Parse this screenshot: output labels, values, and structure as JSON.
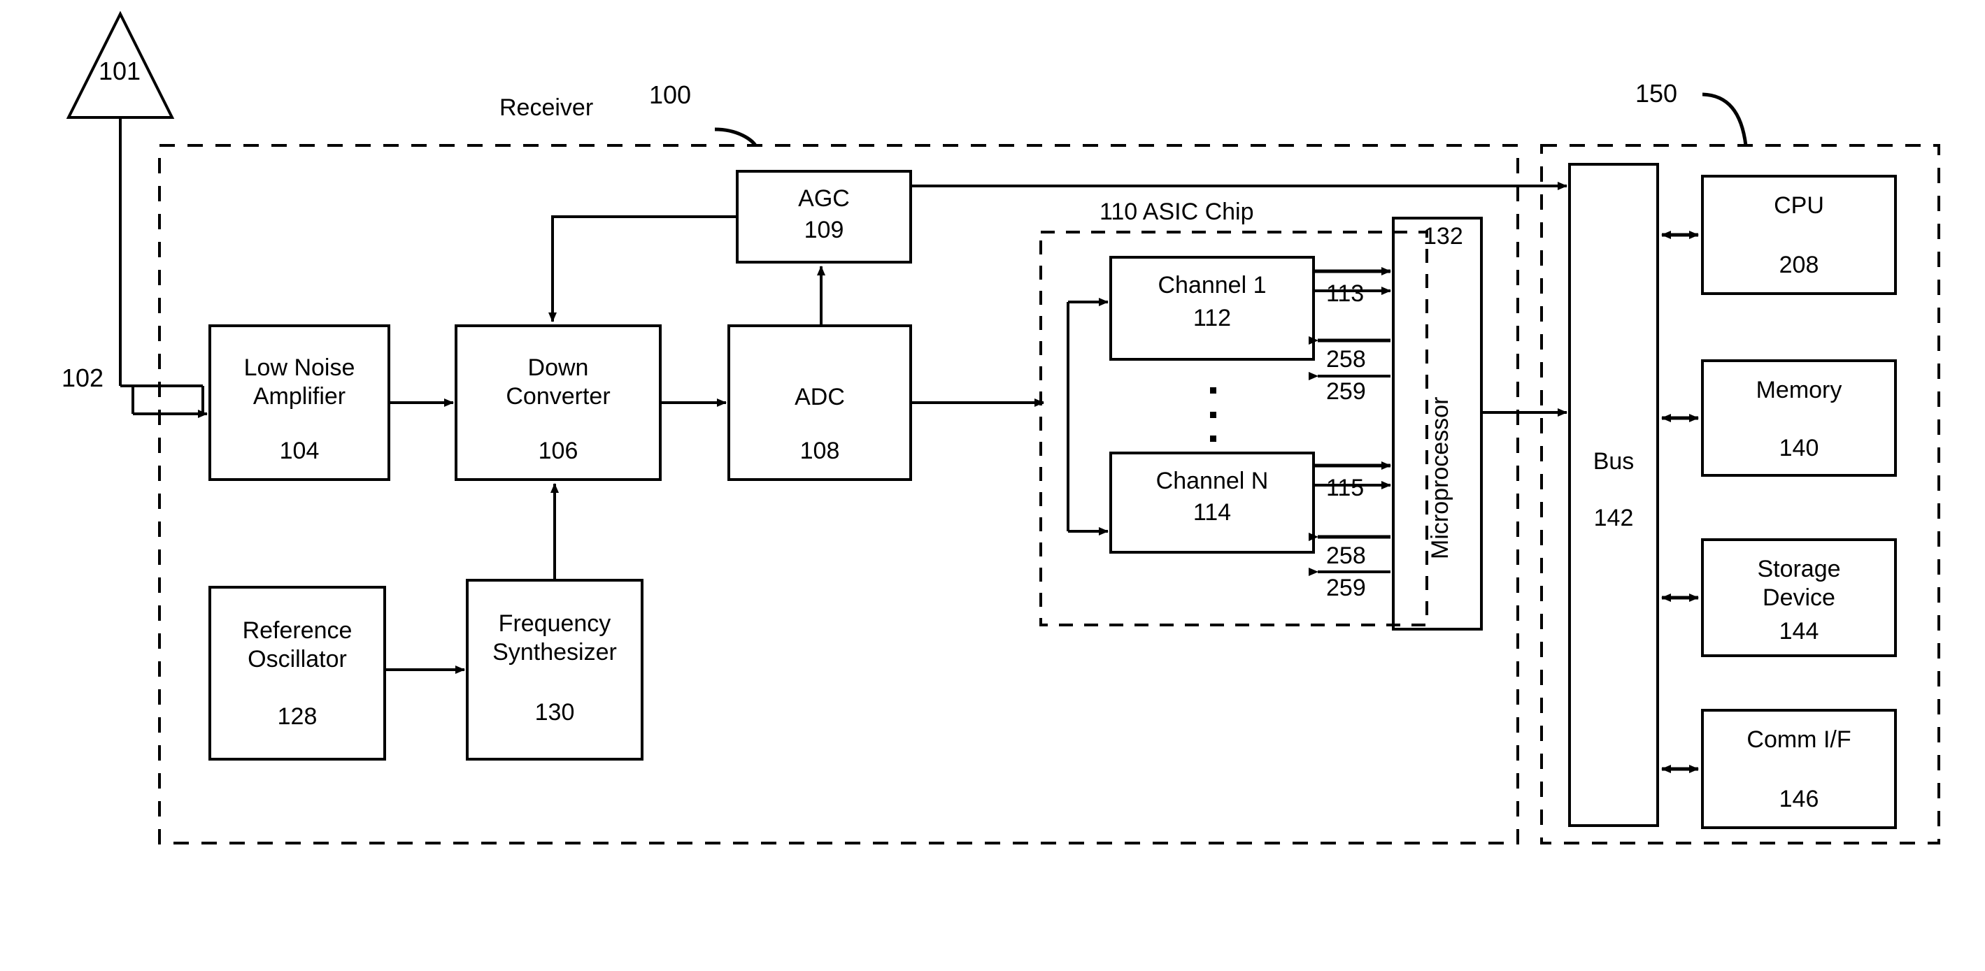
{
  "figure": {
    "type": "patent-block-diagram",
    "antenna": {
      "ref": "101",
      "feed_ref": "102"
    },
    "receiver_group": {
      "title": "Receiver",
      "ref": "100"
    },
    "asic_group": {
      "title": "110 ASIC Chip"
    },
    "computer_group": {
      "ref": "150"
    },
    "blocks": [
      {
        "id": "lna",
        "name": "Low Noise\nAmplifier",
        "ref": "104"
      },
      {
        "id": "dc",
        "name": "Down\nConverter",
        "ref": "106"
      },
      {
        "id": "adc",
        "name": "ADC",
        "ref": "108"
      },
      {
        "id": "agc",
        "name": "AGC",
        "ref": "109"
      },
      {
        "id": "refosc",
        "name": "Reference\nOscillator",
        "ref": "128"
      },
      {
        "id": "fsynth",
        "name": "Frequency\nSynthesizer",
        "ref": "130"
      },
      {
        "id": "ch1",
        "name": "Channel 1",
        "ref": "112"
      },
      {
        "id": "chn",
        "name": "Channel N",
        "ref": "114"
      },
      {
        "id": "micro",
        "name": "Microprocessor",
        "ref": "132"
      },
      {
        "id": "bus",
        "name": "Bus",
        "ref": "142"
      },
      {
        "id": "cpu",
        "name": "CPU",
        "ref": "208"
      },
      {
        "id": "mem",
        "name": "Memory",
        "ref": "140"
      },
      {
        "id": "stor",
        "name": "Storage\nDevice",
        "ref": "144"
      },
      {
        "id": "comm",
        "name": "Comm I/F",
        "ref": "146"
      }
    ],
    "signal_labels": {
      "ch1_out": "113",
      "chn_out": "115",
      "ch1_in_a": "258",
      "ch1_in_b": "259",
      "chn_in_a": "258",
      "chn_in_b": "259"
    },
    "colors": {
      "line": "#000000",
      "background": "#ffffff"
    }
  }
}
